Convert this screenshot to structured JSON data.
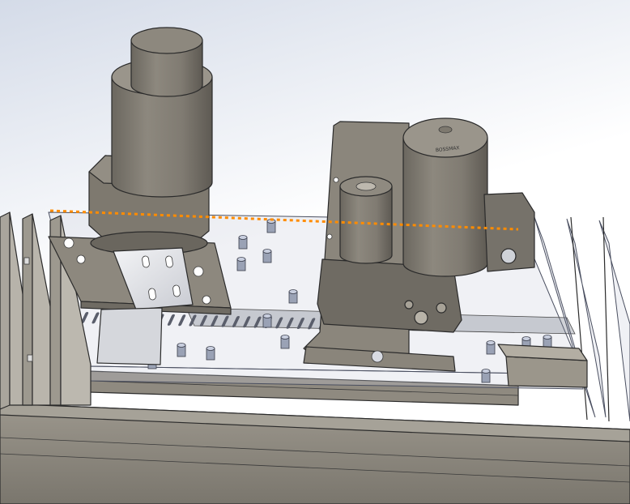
{
  "scene": {
    "background_top": "#d4dbe8",
    "background_bottom": "#ffffff",
    "metal_color": "#8a857c",
    "metal_dark": "#6e6a62",
    "metal_light": "#a8a398",
    "plate_color": "#e4e6ec",
    "glass_tint": "#c8cddc",
    "bracket_color": "#ecedf0",
    "sketch_line_color": "#ff8c00",
    "motor_label": "BOSSMAX"
  }
}
